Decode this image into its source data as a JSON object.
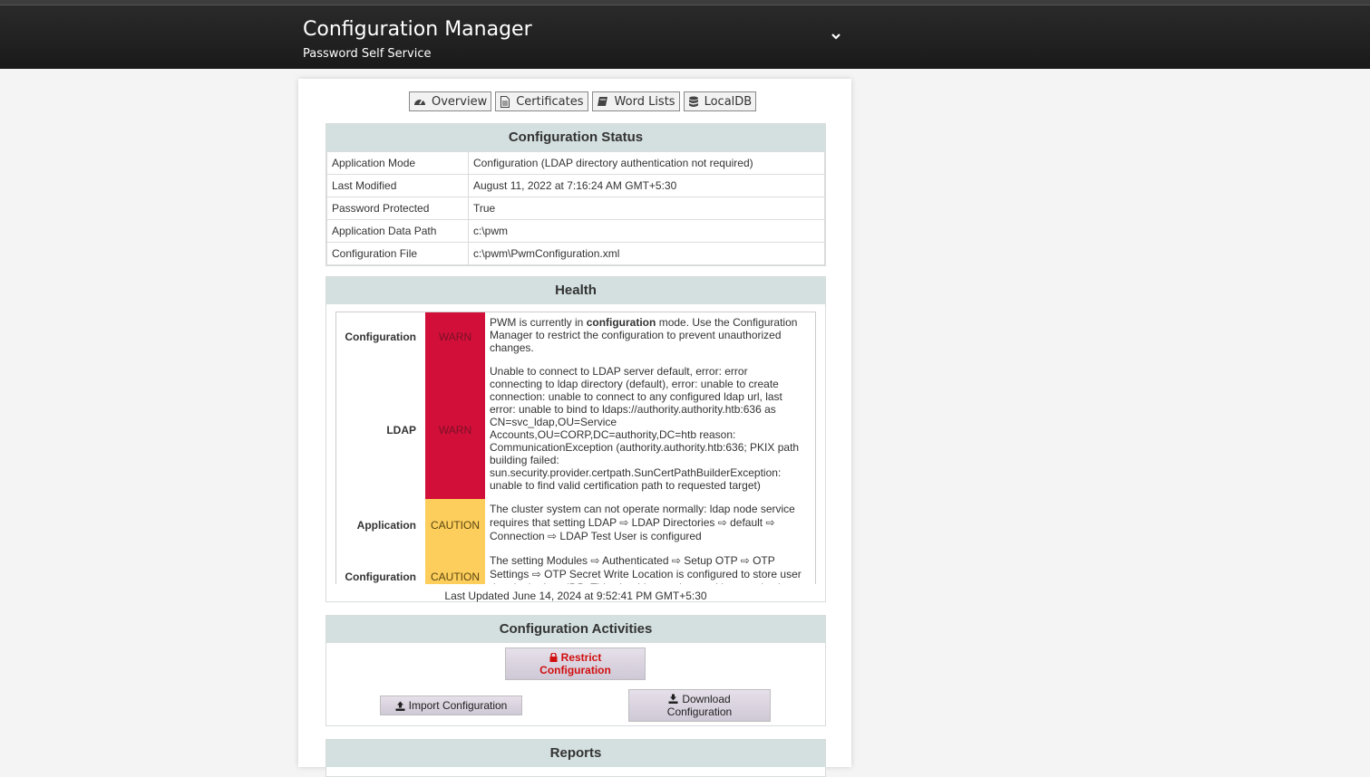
{
  "header": {
    "title": "Configuration Manager",
    "subtitle": "Password Self Service"
  },
  "tabs": [
    {
      "label": "Overview",
      "icon": "dashboard-icon"
    },
    {
      "label": "Certificates",
      "icon": "document-icon"
    },
    {
      "label": "Word Lists",
      "icon": "book-icon"
    },
    {
      "label": "LocalDB",
      "icon": "database-icon"
    }
  ],
  "config_status": {
    "title": "Configuration Status",
    "rows": [
      {
        "key": "Application Mode",
        "value": "Configuration (LDAP directory authentication not required)"
      },
      {
        "key": "Last Modified",
        "value": "August 11, 2022 at 7:16:24 AM GMT+5:30"
      },
      {
        "key": "Password Protected",
        "value": "True"
      },
      {
        "key": "Application Data Path",
        "value": "c:\\pwm"
      },
      {
        "key": "Configuration File",
        "value": "c:\\pwm\\PwmConfiguration.xml"
      }
    ]
  },
  "health": {
    "title": "Health",
    "rows": [
      {
        "topic": "Configuration",
        "status": "WARN",
        "msg_pre": "PWM is currently in ",
        "msg_bold": "configuration",
        "msg_post": " mode. Use the Configuration Manager to restrict the configuration to prevent unauthorized changes."
      },
      {
        "topic": "LDAP",
        "status": "WARN",
        "msg_pre": "Unable to connect to LDAP server default, error: error connecting to ldap directory (default), error: unable to create connection: unable to connect to any configured ldap url, last error: unable to bind to ldaps://authority.authority.htb:636 as CN=svc_ldap,OU=Service Accounts,OU=CORP,DC=authority,DC=htb reason: CommunicationException (authority.authority.htb:636; PKIX path building failed: sun.security.provider.certpath.SunCertPathBuilderException: unable to find valid certification path to requested target)",
        "msg_bold": "",
        "msg_post": ""
      },
      {
        "topic": "Application",
        "status": "CAUTION",
        "msg_pre": "The cluster system can not operate normally: ldap node service requires that setting LDAP ⇨ LDAP Directories ⇨ default ⇨ Connection ⇨ LDAP Test User is configured",
        "msg_bold": "",
        "msg_post": ""
      },
      {
        "topic": "Configuration",
        "status": "CAUTION",
        "msg_pre": "The setting Modules ⇨ Authenticated ⇨ Setup OTP ⇨ OTP Settings ⇨ OTP Secret Write Location is configured to store user data in the LocalDB. This should never be used in a production",
        "msg_bold": "",
        "msg_post": ""
      }
    ],
    "last_updated": "Last Updated June 14, 2024 at 9:52:41 PM GMT+5:30"
  },
  "activities": {
    "title": "Configuration Activities",
    "restrict_label": "Restrict Configuration",
    "import_label": "Import Configuration",
    "download_label": "Download Configuration"
  },
  "reports": {
    "title": "Reports"
  },
  "colors": {
    "warn": "#d20f39",
    "caution": "#fdce5c",
    "section_header": "#d4dfdf",
    "danger_text": "#d20f0f"
  }
}
